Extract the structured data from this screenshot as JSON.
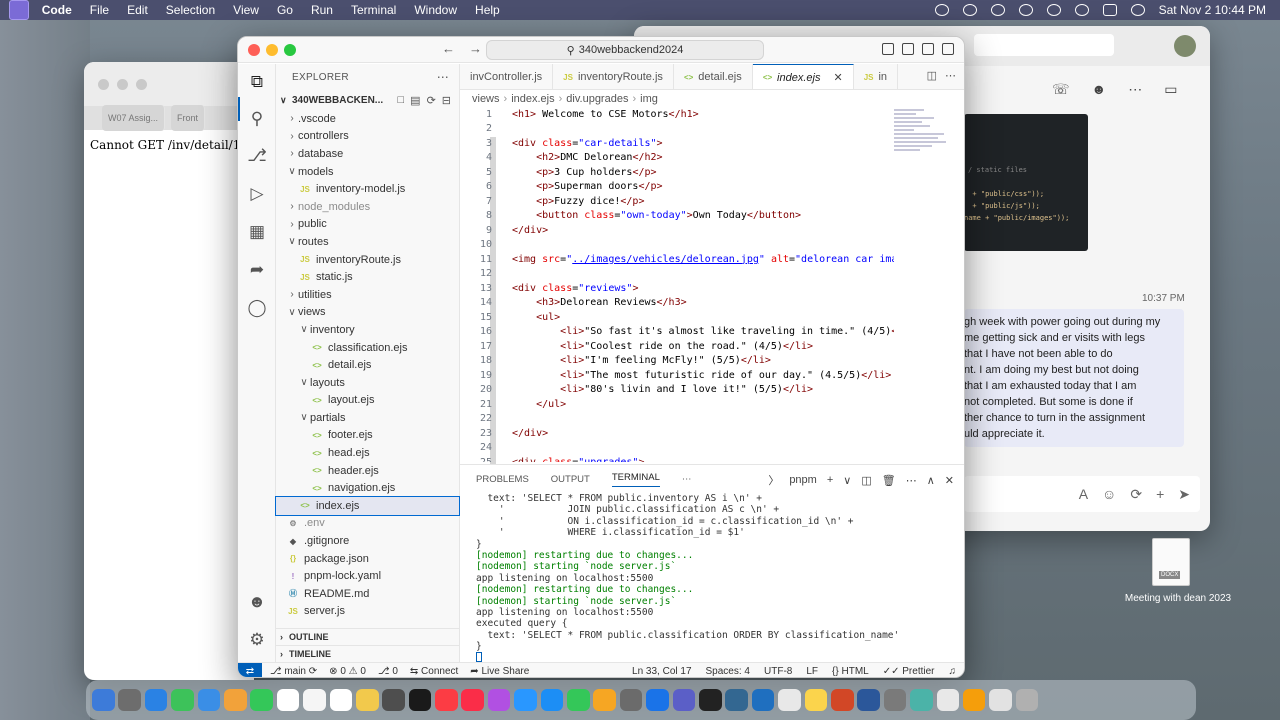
{
  "menubar": {
    "app": "Code",
    "items": [
      "File",
      "Edit",
      "Selection",
      "View",
      "Go",
      "Run",
      "Terminal",
      "Window",
      "Help"
    ],
    "datetime": "Sat Nov 2  10:44 PM"
  },
  "browser": {
    "tabs": [
      "W07 Assig...",
      "Front"
    ],
    "content": "Cannot GET /inv/detail/1"
  },
  "teams": {
    "code_lines": [
      "/ static files",
      "  + \"public/css\"));",
      "  + \"public/js\"));",
      "name + \"public/images\"));"
    ],
    "time": "10:37 PM",
    "message_lines": [
      "gh week with power going out during my",
      "me getting sick and er visits with legs",
      "that I have not been able to do",
      "nt.  I am doing my best but not doing",
      "that I am exhausted today that I am",
      "not completed. But some is done if",
      "ther chance to turn in the assignment",
      "uld appreciate it."
    ]
  },
  "desktop": {
    "file_badge": "DOCX",
    "file_label": "Meeting with dean 2023"
  },
  "vscode": {
    "command_center": "340webbackend2024",
    "explorer_title": "EXPLORER",
    "project": "340WEBBACKEN...",
    "tree": [
      {
        "label": ".vscode",
        "depth": 0,
        "kind": "folder-closed"
      },
      {
        "label": "controllers",
        "depth": 0,
        "kind": "folder-closed"
      },
      {
        "label": "database",
        "depth": 0,
        "kind": "folder-closed"
      },
      {
        "label": "models",
        "depth": 0,
        "kind": "folder-open"
      },
      {
        "label": "inventory-model.js",
        "depth": 1,
        "kind": "js"
      },
      {
        "label": "node_modules",
        "depth": 0,
        "kind": "folder-closed",
        "dim": true
      },
      {
        "label": "public",
        "depth": 0,
        "kind": "folder-closed"
      },
      {
        "label": "routes",
        "depth": 0,
        "kind": "folder-open"
      },
      {
        "label": "inventoryRoute.js",
        "depth": 1,
        "kind": "js"
      },
      {
        "label": "static.js",
        "depth": 1,
        "kind": "js"
      },
      {
        "label": "utilities",
        "depth": 0,
        "kind": "folder-closed"
      },
      {
        "label": "views",
        "depth": 0,
        "kind": "folder-open"
      },
      {
        "label": "inventory",
        "depth": 1,
        "kind": "folder-open"
      },
      {
        "label": "classification.ejs",
        "depth": 2,
        "kind": "ejs"
      },
      {
        "label": "detail.ejs",
        "depth": 2,
        "kind": "ejs"
      },
      {
        "label": "layouts",
        "depth": 1,
        "kind": "folder-open"
      },
      {
        "label": "layout.ejs",
        "depth": 2,
        "kind": "ejs"
      },
      {
        "label": "partials",
        "depth": 1,
        "kind": "folder-open"
      },
      {
        "label": "footer.ejs",
        "depth": 2,
        "kind": "ejs"
      },
      {
        "label": "head.ejs",
        "depth": 2,
        "kind": "ejs"
      },
      {
        "label": "header.ejs",
        "depth": 2,
        "kind": "ejs"
      },
      {
        "label": "navigation.ejs",
        "depth": 2,
        "kind": "ejs"
      },
      {
        "label": "index.ejs",
        "depth": 1,
        "kind": "ejs",
        "selected": true
      },
      {
        "label": ".env",
        "depth": 0,
        "kind": "env",
        "dim": true
      },
      {
        "label": ".gitignore",
        "depth": 0,
        "kind": "git"
      },
      {
        "label": "package.json",
        "depth": 0,
        "kind": "json"
      },
      {
        "label": "pnpm-lock.yaml",
        "depth": 0,
        "kind": "yaml"
      },
      {
        "label": "README.md",
        "depth": 0,
        "kind": "md"
      },
      {
        "label": "server.js",
        "depth": 0,
        "kind": "js"
      }
    ],
    "outline": "OUTLINE",
    "timeline": "TIMELINE",
    "tabs": [
      {
        "label": "invController.js",
        "icon": ""
      },
      {
        "label": "inventoryRoute.js",
        "icon": "JS"
      },
      {
        "label": "detail.ejs",
        "icon": "<>"
      },
      {
        "label": "index.ejs",
        "icon": "<>",
        "active": true
      },
      {
        "label": "in",
        "icon": "JS"
      }
    ],
    "breadcrumb": [
      "views",
      "index.ejs",
      "div.upgrades",
      "img"
    ],
    "code": [
      [
        [
          "tg",
          "<h1>"
        ],
        [
          "tx",
          " Welcome to CSE Motors"
        ],
        [
          "tg",
          "</h1>"
        ]
      ],
      [],
      [
        [
          "tg",
          "<div "
        ],
        [
          "at",
          "class"
        ],
        [
          "tx",
          "="
        ],
        [
          "st",
          "\"car-details\""
        ],
        [
          "tg",
          ">"
        ]
      ],
      [
        [
          "tx",
          "    "
        ],
        [
          "tg",
          "<h2>"
        ],
        [
          "tx",
          "DMC Delorean"
        ],
        [
          "tg",
          "</h2>"
        ]
      ],
      [
        [
          "tx",
          "    "
        ],
        [
          "tg",
          "<p>"
        ],
        [
          "tx",
          "3 Cup holders"
        ],
        [
          "tg",
          "</p>"
        ]
      ],
      [
        [
          "tx",
          "    "
        ],
        [
          "tg",
          "<p>"
        ],
        [
          "tx",
          "Superman doors"
        ],
        [
          "tg",
          "</p>"
        ]
      ],
      [
        [
          "tx",
          "    "
        ],
        [
          "tg",
          "<p>"
        ],
        [
          "tx",
          "Fuzzy dice!"
        ],
        [
          "tg",
          "</p>"
        ]
      ],
      [
        [
          "tx",
          "    "
        ],
        [
          "tg",
          "<button "
        ],
        [
          "at",
          "class"
        ],
        [
          "tx",
          "="
        ],
        [
          "st",
          "\"own-today\""
        ],
        [
          "tg",
          ">"
        ],
        [
          "tx",
          "Own Today"
        ],
        [
          "tg",
          "</button>"
        ]
      ],
      [
        [
          "tg",
          "</div>"
        ]
      ],
      [],
      [
        [
          "tg",
          "<img "
        ],
        [
          "at",
          "src"
        ],
        [
          "tx",
          "="
        ],
        [
          "st",
          "\""
        ],
        [
          "ul",
          "../images/vehicles/delorean.jpg"
        ],
        [
          "st",
          "\""
        ],
        [
          "tx",
          " "
        ],
        [
          "at",
          "alt"
        ],
        [
          "tx",
          "="
        ],
        [
          "st",
          "\"delorean car image"
        ]
      ],
      [],
      [
        [
          "tg",
          "<div "
        ],
        [
          "at",
          "class"
        ],
        [
          "tx",
          "="
        ],
        [
          "st",
          "\"reviews\""
        ],
        [
          "tg",
          ">"
        ]
      ],
      [
        [
          "tx",
          "    "
        ],
        [
          "tg",
          "<h3>"
        ],
        [
          "tx",
          "Delorean Reviews"
        ],
        [
          "tg",
          "</h3>"
        ]
      ],
      [
        [
          "tx",
          "    "
        ],
        [
          "tg",
          "<ul>"
        ]
      ],
      [
        [
          "tx",
          "        "
        ],
        [
          "tg",
          "<li>"
        ],
        [
          "tx",
          "\"So fast it's almost like traveling in time.\" (4/5)"
        ],
        [
          "tg",
          "</l"
        ]
      ],
      [
        [
          "tx",
          "        "
        ],
        [
          "tg",
          "<li>"
        ],
        [
          "tx",
          "\"Coolest ride on the road.\" (4/5)"
        ],
        [
          "tg",
          "</li>"
        ]
      ],
      [
        [
          "tx",
          "        "
        ],
        [
          "tg",
          "<li>"
        ],
        [
          "tx",
          "\"I'm feeling McFly!\" (5/5)"
        ],
        [
          "tg",
          "</li>"
        ]
      ],
      [
        [
          "tx",
          "        "
        ],
        [
          "tg",
          "<li>"
        ],
        [
          "tx",
          "\"The most futuristic ride of our day.\" (4.5/5)"
        ],
        [
          "tg",
          "</li>"
        ]
      ],
      [
        [
          "tx",
          "        "
        ],
        [
          "tg",
          "<li>"
        ],
        [
          "tx",
          "\"80's livin and I love it!\" (5/5)"
        ],
        [
          "tg",
          "</li>"
        ]
      ],
      [
        [
          "tx",
          "    "
        ],
        [
          "tg",
          "</ul>"
        ]
      ],
      [],
      [
        [
          "tg",
          "</div>"
        ]
      ],
      [],
      [
        [
          "tg",
          "<div "
        ],
        [
          "at",
          "class"
        ],
        [
          "tx",
          "="
        ],
        [
          "st",
          "\"upgrades\""
        ],
        [
          "tg",
          ">"
        ]
      ]
    ],
    "panel_tabs": [
      "PROBLEMS",
      "OUTPUT",
      "TERMINAL"
    ],
    "terminal_shell": "pnpm",
    "terminal": [
      [
        "",
        "  text: 'SELECT * FROM public.inventory AS i \\n' +"
      ],
      [
        "",
        "    '           JOIN public.classification AS c \\n' +"
      ],
      [
        "",
        "    '           ON i.classification_id = c.classification_id \\n' +"
      ],
      [
        "",
        "    '           WHERE i.classification_id = $1'"
      ],
      [
        "",
        "}"
      ],
      [
        "g",
        "[nodemon] restarting due to changes..."
      ],
      [
        "g",
        "[nodemon] starting `node server.js`"
      ],
      [
        "",
        "app listening on localhost:5500"
      ],
      [
        "g",
        "[nodemon] restarting due to changes..."
      ],
      [
        "g",
        "[nodemon] starting `node server.js`"
      ],
      [
        "",
        "app listening on localhost:5500"
      ],
      [
        "",
        "executed query {"
      ],
      [
        "",
        "  text: 'SELECT * FROM public.classification ORDER BY classification_name'"
      ],
      [
        "",
        "}"
      ]
    ],
    "status": {
      "branch": "main",
      "problems": "0 ⚠ 0",
      "ports": "0",
      "connect": "Connect",
      "liveshare": "Live Share",
      "position": "Ln 33, Col 17",
      "spaces": "Spaces: 4",
      "encoding": "UTF-8",
      "eol": "LF",
      "language": "HTML",
      "prettier": "Prettier"
    }
  },
  "dock_colors": [
    "#3d7bd9",
    "#6d6d6d",
    "#2a82e4",
    "#3dc25a",
    "#3a8ee6",
    "#f2a23a",
    "#34c759",
    "#ffffff",
    "#f5f5f5",
    "#ffffff",
    "#f2c94c",
    "#4e4e4e",
    "#1a1a1a",
    "#fc3c44",
    "#fa2d48",
    "#b150e2",
    "#2997ff",
    "#1c8ef5",
    "#34c759",
    "#f6a623",
    "#6b6b6b",
    "#1a73e8",
    "#5b5fc7",
    "#222222",
    "#336791",
    "#1f6fbf",
    "#e8e8e8",
    "#fbd44c",
    "#d24726",
    "#2b579a",
    "#7a7a7a",
    "#4bb3a8",
    "#e8e8e8",
    "#f59e0b",
    "#e2e2e2",
    "#b0b0b0"
  ]
}
